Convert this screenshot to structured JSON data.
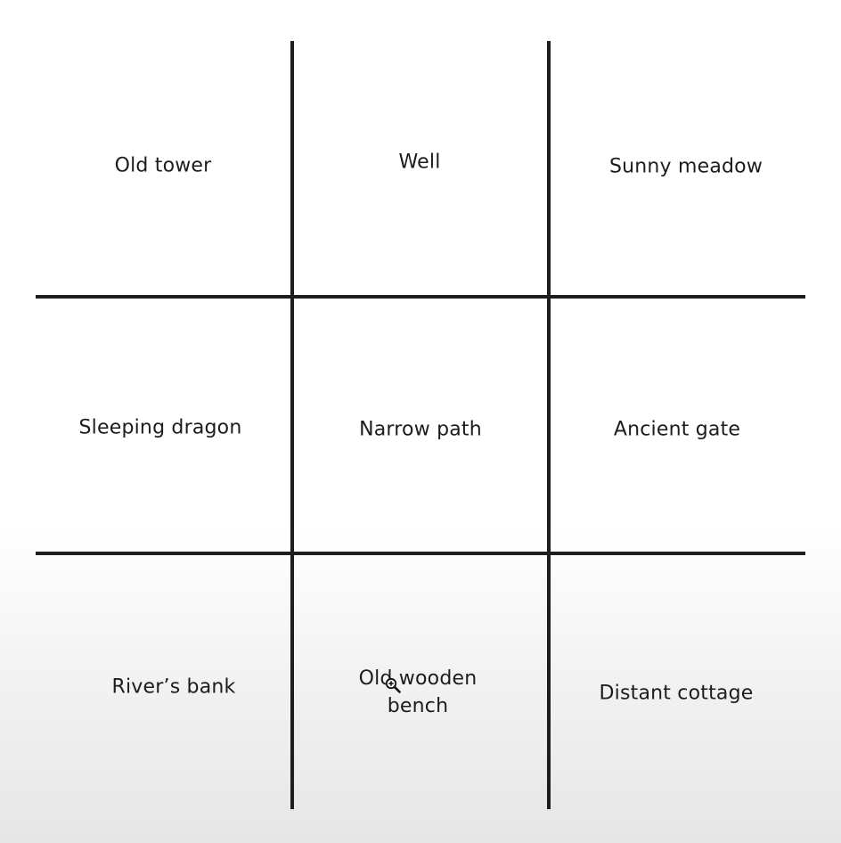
{
  "grid": {
    "rows": 3,
    "columns": 3,
    "cells": [
      {
        "label": "Old tower"
      },
      {
        "label": "Well"
      },
      {
        "label": "Sunny meadow"
      },
      {
        "label": "Sleeping dragon"
      },
      {
        "label": "Narrow path"
      },
      {
        "label": "Ancient gate"
      },
      {
        "label": "River’s bank"
      },
      {
        "label": "Old wooden bench"
      },
      {
        "label": "Distant cottage"
      }
    ]
  },
  "colors": {
    "line": "#1e1e1e",
    "text": "#1c1c1c",
    "background": "#ffffff"
  },
  "cursor": {
    "icon": "zoom-in-cursor-icon"
  }
}
